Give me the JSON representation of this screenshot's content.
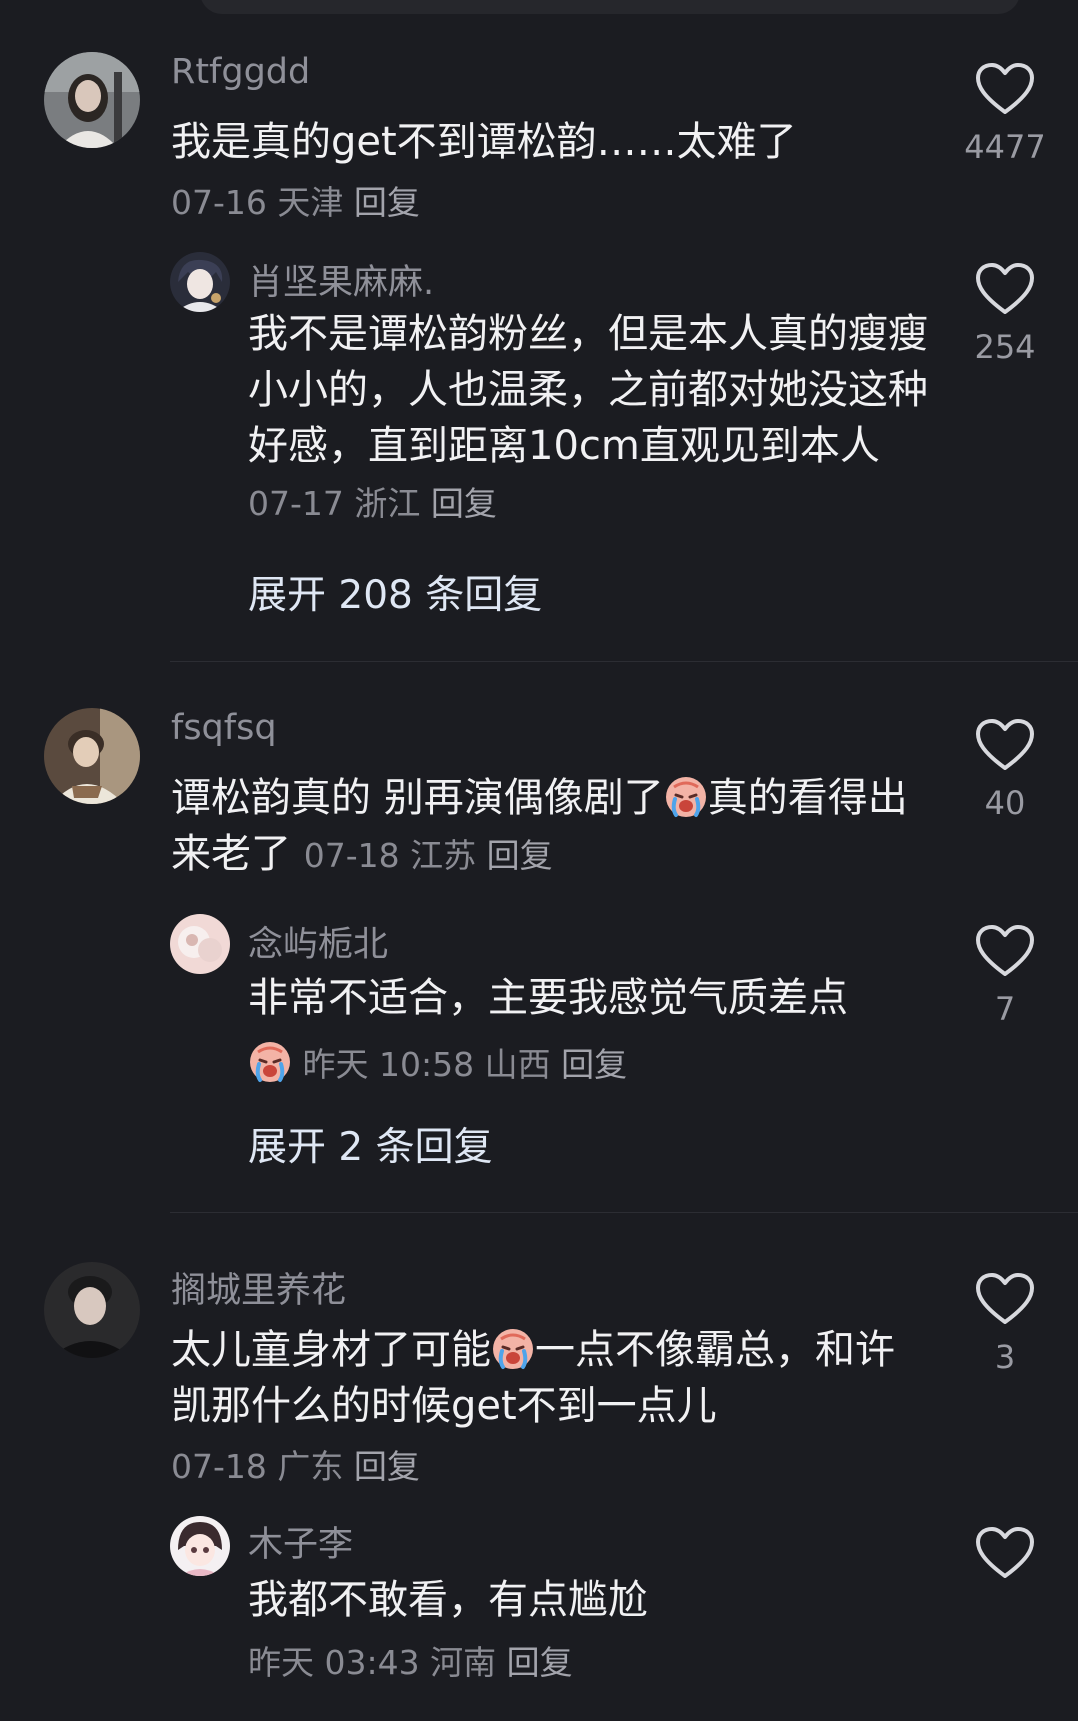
{
  "comments": [
    {
      "username": "Rtfggdd",
      "text": "我是真的get不到谭松韵……太难了",
      "meta": "07-16 天津",
      "reply_label": "回复",
      "likes": "4477",
      "avatar_icon": "girl-portrait-avatar",
      "subreply": {
        "username": "肖坚果麻麻.",
        "text": "我不是谭松韵粉丝，但是本人真的瘦瘦小小的，人也温柔，之前都对她没这种好感，直到距离10cm直观见到本人",
        "meta": "07-17 浙江",
        "reply_label": "回复",
        "likes": "254",
        "avatar_icon": "anime-boy-avatar"
      },
      "expand_label": "展开 208 条回复"
    },
    {
      "username": "fsqfsq",
      "text_before_emoji": "谭松韵真的 别再演偶像剧了",
      "emoji": "crying-face-emoji",
      "text_after_emoji": "真的看得出来老了",
      "meta": "07-18 江苏",
      "reply_label": "回复",
      "likes": "40",
      "avatar_icon": "boy-portrait-avatar",
      "subreply": {
        "username": "念屿栀北",
        "text": "非常不适合，主要我感觉气质差点",
        "emoji": "crying-face-emoji",
        "meta": "昨天 10:58 山西",
        "reply_label": "回复",
        "likes": "7",
        "avatar_icon": "flower-avatar"
      },
      "expand_label": "展开 2 条回复"
    },
    {
      "username": "搁城里养花",
      "text_before_emoji": "太儿童身材了可能",
      "emoji": "crying-face-emoji",
      "text_after_emoji": "一点不像霸总，和许凯那什么的时候get不到一点儿",
      "meta": "07-18 广东",
      "reply_label": "回复",
      "likes": "3",
      "avatar_icon": "dark-boy-avatar",
      "subreply": {
        "username": "木子李",
        "text": "我都不敢看，有点尴尬",
        "meta": "昨天 03:43 河南",
        "reply_label": "回复",
        "likes": "",
        "avatar_icon": "cartoon-girl-avatar"
      }
    }
  ],
  "colors": {
    "background": "#1b1c21",
    "username": "#8f9099",
    "text": "#f1f1f3",
    "meta": "#8a8b93",
    "expand": "#dfe7f4"
  },
  "icons": {
    "like": "heart-outline-icon"
  }
}
